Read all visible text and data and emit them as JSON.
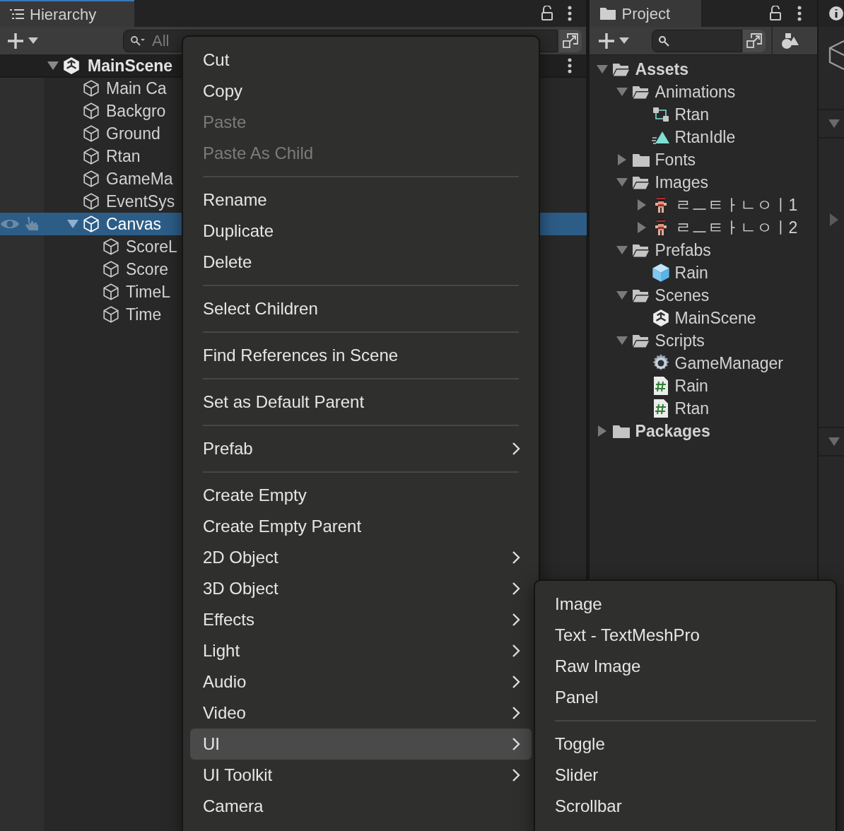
{
  "hierarchy": {
    "tab": "Hierarchy",
    "search": {
      "placeholder": "All"
    },
    "scene": {
      "name": "MainScene",
      "expanded": true
    },
    "objects": [
      {
        "name": "Main Ca",
        "selected": false
      },
      {
        "name": "Backgro",
        "selected": false
      },
      {
        "name": "Ground",
        "selected": false
      },
      {
        "name": "Rtan",
        "selected": false
      },
      {
        "name": "GameMa",
        "selected": false
      },
      {
        "name": "EventSys",
        "selected": false
      },
      {
        "name": "Canvas",
        "selected": true,
        "expanded": true,
        "children": [
          {
            "name": "ScoreL",
            "selected": false
          },
          {
            "name": "Score",
            "selected": false
          },
          {
            "name": "TimeL",
            "selected": false
          },
          {
            "name": "Time",
            "selected": false
          }
        ]
      }
    ]
  },
  "project": {
    "tab": "Project",
    "tree": [
      {
        "name": "Assets",
        "kind": "root",
        "expanded": true,
        "children": [
          {
            "name": "Animations",
            "kind": "folder",
            "expanded": true,
            "children": [
              {
                "name": "Rtan",
                "kind": "animator"
              },
              {
                "name": "RtanIdle",
                "kind": "animation"
              }
            ]
          },
          {
            "name": "Fonts",
            "kind": "folder",
            "expanded": false
          },
          {
            "name": "Images",
            "kind": "folder",
            "expanded": true,
            "children": [
              {
                "name": "ㄹㅡㅌㅏㄴㅇㅣ1",
                "kind": "sprite",
                "expanded": false
              },
              {
                "name": "ㄹㅡㅌㅏㄴㅇㅣ2",
                "kind": "sprite",
                "expanded": false
              }
            ]
          },
          {
            "name": "Prefabs",
            "kind": "folder",
            "expanded": true,
            "children": [
              {
                "name": "Rain",
                "kind": "prefab"
              }
            ]
          },
          {
            "name": "Scenes",
            "kind": "folder",
            "expanded": true,
            "children": [
              {
                "name": "MainScene",
                "kind": "scene"
              }
            ]
          },
          {
            "name": "Scripts",
            "kind": "folder",
            "expanded": true,
            "children": [
              {
                "name": "GameManager",
                "kind": "manager"
              },
              {
                "name": "Rain",
                "kind": "script"
              },
              {
                "name": "Rtan",
                "kind": "script"
              }
            ]
          }
        ]
      },
      {
        "name": "Packages",
        "kind": "root",
        "expanded": false
      }
    ]
  },
  "context_menu": [
    {
      "kind": "item",
      "label": "Cut",
      "disabled": false,
      "submenu": false,
      "selected": false
    },
    {
      "kind": "item",
      "label": "Copy",
      "disabled": false,
      "submenu": false,
      "selected": false
    },
    {
      "kind": "item",
      "label": "Paste",
      "disabled": true,
      "submenu": false,
      "selected": false
    },
    {
      "kind": "item",
      "label": "Paste As Child",
      "disabled": true,
      "submenu": false,
      "selected": false
    },
    {
      "kind": "separator"
    },
    {
      "kind": "item",
      "label": "Rename",
      "disabled": false,
      "submenu": false,
      "selected": false
    },
    {
      "kind": "item",
      "label": "Duplicate",
      "disabled": false,
      "submenu": false,
      "selected": false
    },
    {
      "kind": "item",
      "label": "Delete",
      "disabled": false,
      "submenu": false,
      "selected": false
    },
    {
      "kind": "separator"
    },
    {
      "kind": "item",
      "label": "Select Children",
      "disabled": false,
      "submenu": false,
      "selected": false
    },
    {
      "kind": "separator"
    },
    {
      "kind": "item",
      "label": "Find References in Scene",
      "disabled": false,
      "submenu": false,
      "selected": false
    },
    {
      "kind": "separator"
    },
    {
      "kind": "item",
      "label": "Set as Default Parent",
      "disabled": false,
      "submenu": false,
      "selected": false
    },
    {
      "kind": "separator"
    },
    {
      "kind": "item",
      "label": "Prefab",
      "disabled": false,
      "submenu": true,
      "selected": false
    },
    {
      "kind": "separator"
    },
    {
      "kind": "item",
      "label": "Create Empty",
      "disabled": false,
      "submenu": false,
      "selected": false
    },
    {
      "kind": "item",
      "label": "Create Empty Parent",
      "disabled": false,
      "submenu": false,
      "selected": false
    },
    {
      "kind": "item",
      "label": "2D Object",
      "disabled": false,
      "submenu": true,
      "selected": false
    },
    {
      "kind": "item",
      "label": "3D Object",
      "disabled": false,
      "submenu": true,
      "selected": false
    },
    {
      "kind": "item",
      "label": "Effects",
      "disabled": false,
      "submenu": true,
      "selected": false
    },
    {
      "kind": "item",
      "label": "Light",
      "disabled": false,
      "submenu": true,
      "selected": false
    },
    {
      "kind": "item",
      "label": "Audio",
      "disabled": false,
      "submenu": true,
      "selected": false
    },
    {
      "kind": "item",
      "label": "Video",
      "disabled": false,
      "submenu": true,
      "selected": false
    },
    {
      "kind": "item",
      "label": "UI",
      "disabled": false,
      "submenu": true,
      "selected": true
    },
    {
      "kind": "item",
      "label": "UI Toolkit",
      "disabled": false,
      "submenu": true,
      "selected": false
    },
    {
      "kind": "item",
      "label": "Camera",
      "disabled": false,
      "submenu": false,
      "selected": false
    }
  ],
  "ui_submenu": [
    {
      "kind": "item",
      "label": "Image"
    },
    {
      "kind": "item",
      "label": "Text - TextMeshPro"
    },
    {
      "kind": "item",
      "label": "Raw Image"
    },
    {
      "kind": "item",
      "label": "Panel"
    },
    {
      "kind": "separator"
    },
    {
      "kind": "item",
      "label": "Toggle"
    },
    {
      "kind": "item",
      "label": "Slider"
    },
    {
      "kind": "item",
      "label": "Scrollbar"
    }
  ]
}
